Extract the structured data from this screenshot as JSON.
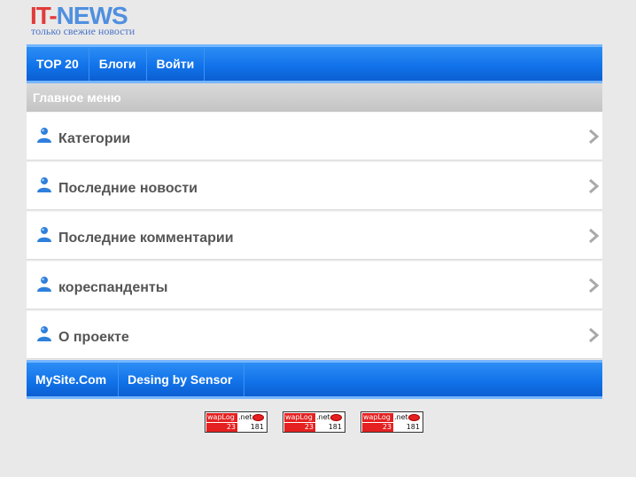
{
  "logo": {
    "main_left": "IT-",
    "main_right": "NEWS",
    "tagline": "только свежие новости"
  },
  "top_nav": [
    {
      "label": "TOP 20"
    },
    {
      "label": "Блоги"
    },
    {
      "label": "Войти"
    }
  ],
  "section_title": "Главное меню",
  "menu": [
    {
      "label": "Категории",
      "icon": "user-icon"
    },
    {
      "label": "Последние новости",
      "icon": "user-icon"
    },
    {
      "label": "Последние комментарии",
      "icon": "user-icon"
    },
    {
      "label": "кореспанденты",
      "icon": "user-icon"
    },
    {
      "label": "О проекте",
      "icon": "user-icon"
    }
  ],
  "footer_nav": [
    {
      "label": "MySite.Com"
    },
    {
      "label": "Desing by Sensor"
    }
  ],
  "counters": [
    {
      "brand": "wapLog",
      "domain": ".net",
      "today": "23",
      "total": "181"
    },
    {
      "brand": "wapLog",
      "domain": ".net",
      "today": "23",
      "total": "181"
    },
    {
      "brand": "wapLog",
      "domain": ".net",
      "today": "23",
      "total": "181"
    }
  ],
  "colors": {
    "accent": "#1273ea",
    "accent_light": "#76b6ff",
    "logo_red": "#e23b3b",
    "logo_blue": "#4f8fe0"
  }
}
